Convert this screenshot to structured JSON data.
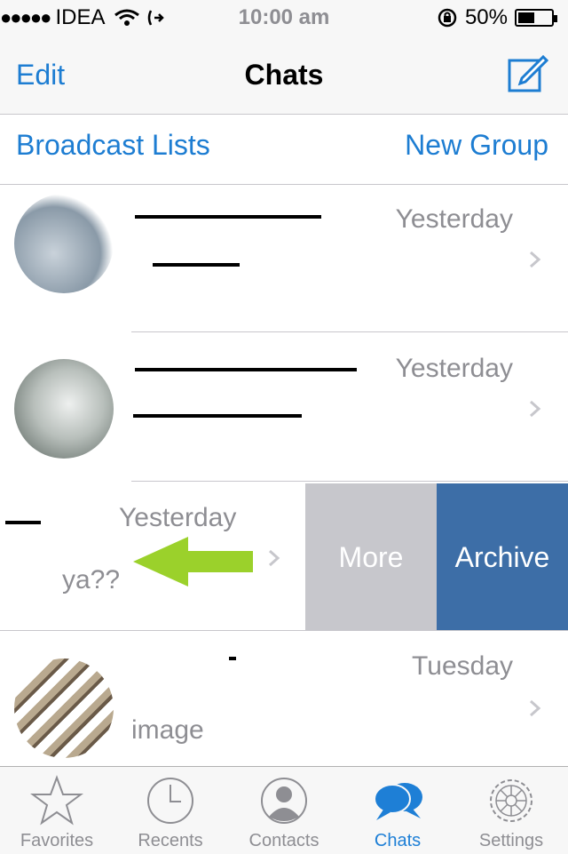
{
  "status_bar": {
    "signal_dots": "●●●●●",
    "carrier": "IDEA",
    "time": "10:00 am",
    "battery_percent": "50%",
    "battery_level": 0.5
  },
  "nav": {
    "edit_label": "Edit",
    "title": "Chats"
  },
  "broadcast": {
    "left_label": "Broadcast Lists",
    "right_label": "New Group"
  },
  "chats": [
    {
      "time": "Yesterday",
      "preview": ""
    },
    {
      "time": "Yesterday",
      "preview": ""
    },
    {
      "time": "Yesterday",
      "preview": "ya??"
    },
    {
      "time": "Tuesday",
      "preview": "image"
    }
  ],
  "swipe_actions": {
    "more_label": "More",
    "archive_label": "Archive"
  },
  "tabs": [
    {
      "label": "Favorites",
      "icon": "star-icon",
      "active": false
    },
    {
      "label": "Recents",
      "icon": "clock-icon",
      "active": false
    },
    {
      "label": "Contacts",
      "icon": "person-icon",
      "active": false
    },
    {
      "label": "Chats",
      "icon": "chat-bubbles-icon",
      "active": true
    },
    {
      "label": "Settings",
      "icon": "gear-icon",
      "active": false
    }
  ],
  "colors": {
    "accent": "#1d7dd2",
    "archive": "#3d6ea7",
    "more": "#c7c7cc",
    "arrow": "#9bd12b"
  }
}
